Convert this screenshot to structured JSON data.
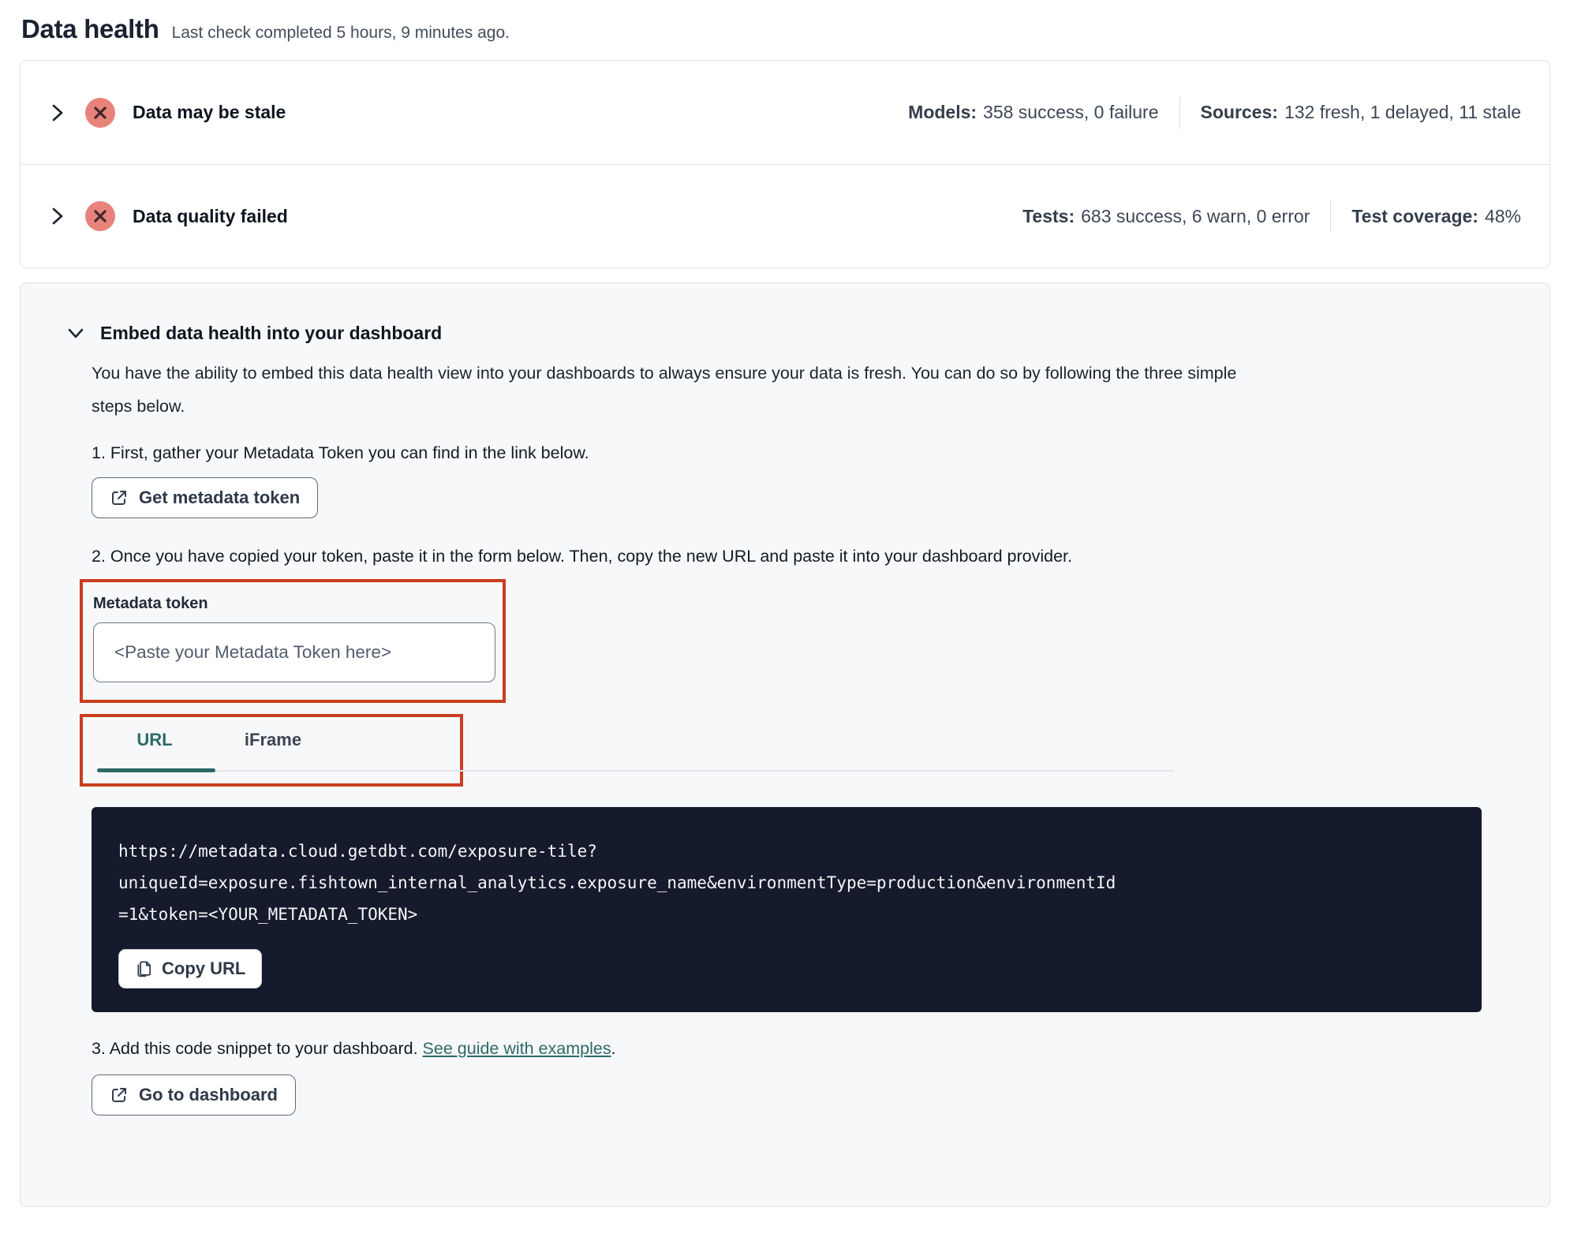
{
  "header": {
    "title": "Data health",
    "subtitle": "Last check completed 5 hours, 9 minutes ago."
  },
  "status_card": {
    "rows": [
      {
        "label": "Data may be stale",
        "status_icon": "error-circle-x-icon",
        "stats": [
          {
            "label": "Models:",
            "value": "358 success, 0 failure"
          },
          {
            "label": "Sources:",
            "value": "132 fresh, 1 delayed, 11 stale"
          }
        ]
      },
      {
        "label": "Data quality failed",
        "status_icon": "error-circle-x-icon",
        "stats": [
          {
            "label": "Tests:",
            "value": "683 success, 6 warn, 0 error"
          },
          {
            "label": "Test coverage:",
            "value": "48%"
          }
        ]
      }
    ]
  },
  "embed": {
    "title": "Embed data health into your dashboard",
    "description": "You have the ability to embed this data health view into your dashboards to always ensure your data is fresh. You can do so by following the three simple steps below.",
    "steps": {
      "step1": "1. First, gather your Metadata Token you can find in the link below.",
      "step2": "2. Once you have copied your token, paste it in the form below. Then, copy the new URL and paste it into your dashboard provider.",
      "step3_text": "3. Add this code snippet to your dashboard.",
      "step3_link": "See guide with examples",
      "step3_period": "."
    },
    "buttons": {
      "get_token": "Get metadata token",
      "copy_url": "Copy URL",
      "go_dashboard": "Go to dashboard"
    },
    "token_field": {
      "label": "Metadata token",
      "value": "",
      "placeholder": "<Paste your Metadata Token here>"
    },
    "tabs": [
      {
        "label": "URL",
        "active": true
      },
      {
        "label": "iFrame",
        "active": false
      }
    ],
    "code": {
      "url": "https://metadata.cloud.getdbt.com/exposure-tile?uniqueId=exposure.fishtown_internal_analytics.exposure_name&environmentType=production&environmentId=1&token=<YOUR_METADATA_TOKEN>",
      "lines": [
        "https://metadata.cloud.getdbt.com/exposure-tile?",
        "uniqueId=exposure.fishtown_internal_analytics.exposure_name&environmentType=production&environmentId",
        "=1&token=<YOUR_METADATA_TOKEN>"
      ]
    }
  },
  "icons": {
    "collapse_row": "chevron-right-icon",
    "expand_section": "chevron-down-icon",
    "status_error": "error-circle-x-icon",
    "external": "external-link-icon",
    "copy": "copy-icon"
  },
  "colors": {
    "annotation_red": "#c93e20",
    "error_salmon": "#e8837c",
    "error_glyph": "#40292c",
    "accent_teal": "#2b6a67",
    "code_background": "#151b2c",
    "section_background": "#f7f8f9",
    "card_border": "#dfe2e7",
    "text_dark": "#1a2230"
  }
}
